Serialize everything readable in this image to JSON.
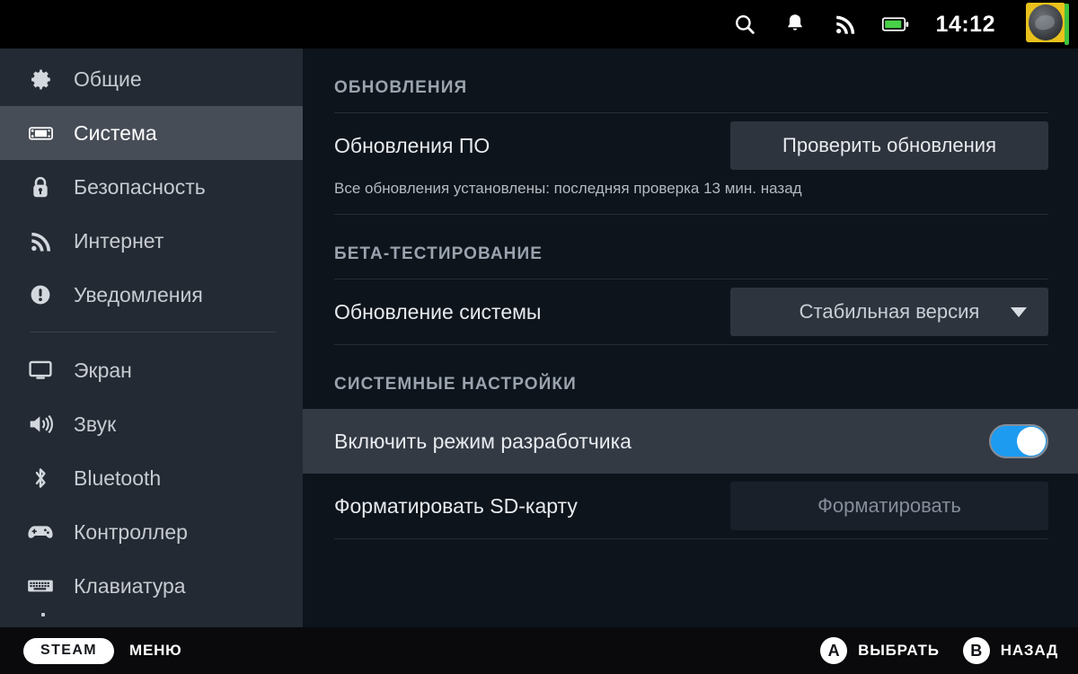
{
  "statusbar": {
    "icons": [
      "search-icon",
      "notification-bell-icon",
      "wifi-icon",
      "battery-icon"
    ],
    "clock": "14:12",
    "battery_color": "#49d049",
    "online_color": "#3fc13f"
  },
  "sidebar": {
    "items": [
      {
        "icon": "gear-icon",
        "label": "Общие",
        "selected": false
      },
      {
        "icon": "steamdeck-icon",
        "label": "Система",
        "selected": true
      },
      {
        "icon": "lock-icon",
        "label": "Безопасность",
        "selected": false
      },
      {
        "icon": "wifi-icon",
        "label": "Интернет",
        "selected": false
      },
      {
        "icon": "alert-circle-icon",
        "label": "Уведомления",
        "selected": false
      },
      {
        "icon": "monitor-icon",
        "label": "Экран",
        "selected": false
      },
      {
        "icon": "speaker-icon",
        "label": "Звук",
        "selected": false
      },
      {
        "icon": "bluetooth-icon",
        "label": "Bluetooth",
        "selected": false
      },
      {
        "icon": "gamepad-icon",
        "label": "Контроллер",
        "selected": false
      },
      {
        "icon": "keyboard-icon",
        "label": "Клавиатура",
        "selected": false
      }
    ]
  },
  "content": {
    "sections": [
      {
        "title": "ОБНОВЛЕНИЯ",
        "row_label": "Обновления ПО",
        "button_label": "Проверить обновления",
        "subtext": "Все обновления установлены: последняя проверка 13 мин. назад"
      },
      {
        "title": "БЕТА-ТЕСТИРОВАНИЕ",
        "row_label": "Обновление системы",
        "dropdown_value": "Стабильная версия"
      },
      {
        "title": "СИСТЕМНЫЕ НАСТРОЙКИ",
        "toggle_row_label": "Включить режим разработчика",
        "toggle_on": true,
        "toggle_accent": "#1d9bf0",
        "format_row_label": "Форматировать SD-карту",
        "format_button_label": "Форматировать",
        "format_button_disabled": true
      }
    ]
  },
  "footer": {
    "steam_pill": "STEAM",
    "menu_label": "МЕНЮ",
    "hints": [
      {
        "badge": "A",
        "label": "ВЫБРАТЬ"
      },
      {
        "badge": "B",
        "label": "НАЗАД"
      }
    ]
  }
}
